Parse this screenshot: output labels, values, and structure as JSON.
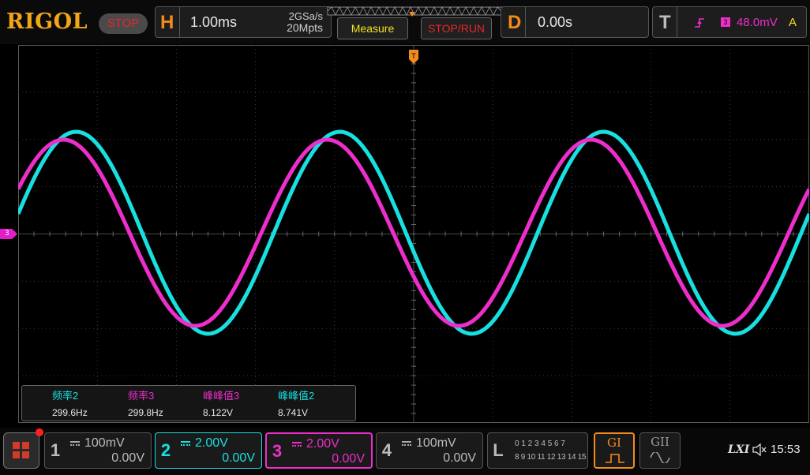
{
  "brand": "RIGOL",
  "run_state": "STOP",
  "horizontal": {
    "letter": "H",
    "timebase": "1.00ms",
    "sample_rate": "2GSa/s",
    "memory_depth": "20Mpts"
  },
  "buttons": {
    "measure": "Measure",
    "stop_run": "STOP/RUN"
  },
  "delay": {
    "letter": "D",
    "value": "0.00s"
  },
  "trigger": {
    "letter": "T",
    "source": "3",
    "level": "48.0mV",
    "mode": "A"
  },
  "offset_marker": "3",
  "measurements": [
    {
      "label": "频率2",
      "value": "299.6Hz",
      "color": "#19e0e0"
    },
    {
      "label": "频率3",
      "value": "299.8Hz",
      "color": "#ee2ecb"
    },
    {
      "label": "峰峰值3",
      "value": "8.122V",
      "color": "#ee2ecb"
    },
    {
      "label": "峰峰值2",
      "value": "8.741V",
      "color": "#19e0e0"
    }
  ],
  "channels": [
    {
      "num": "1",
      "scale": "100mV",
      "offset": "0.00V",
      "active": false
    },
    {
      "num": "2",
      "scale": "2.00V",
      "offset": "0.00V",
      "active": true,
      "color": "#19e0e0"
    },
    {
      "num": "3",
      "scale": "2.00V",
      "offset": "0.00V",
      "active": true,
      "color": "#ee2ecb"
    },
    {
      "num": "4",
      "scale": "100mV",
      "offset": "0.00V",
      "active": false
    }
  ],
  "logic": {
    "letter": "L",
    "row1": "0 1 2 3  4 5 6 7",
    "row2": "8 9 10 11 12 13 14 15"
  },
  "generators": {
    "g1": "GI",
    "g2": "GII"
  },
  "status": {
    "lxi": "LXI",
    "time": "15:53"
  },
  "colors": {
    "ch2": "#19e0e0",
    "ch3": "#ee2ecb",
    "accent": "#f28a1c",
    "brand": "#f2a516"
  }
}
